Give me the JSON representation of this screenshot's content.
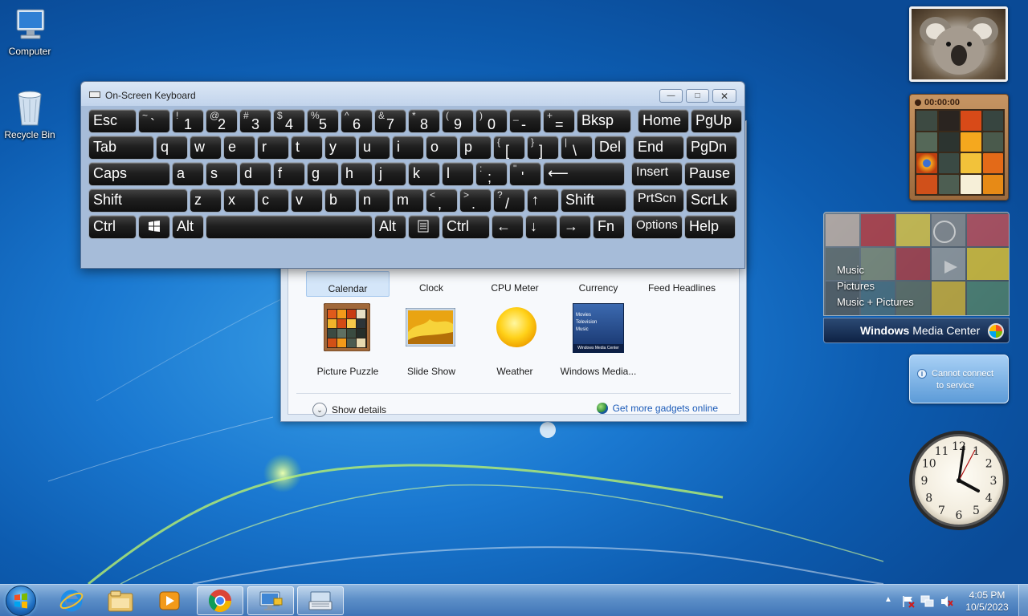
{
  "desktop": {
    "icons": [
      {
        "label": "Computer",
        "icon": "computer-icon"
      },
      {
        "label": "Recycle Bin",
        "icon": "recycle-bin-icon"
      }
    ]
  },
  "osk": {
    "title": "On-Screen Keyboard",
    "rows": [
      [
        {
          "label": "Esc"
        },
        {
          "shift": "~",
          "main": "`"
        },
        {
          "shift": "!",
          "main": "1"
        },
        {
          "shift": "@",
          "main": "2"
        },
        {
          "shift": "#",
          "main": "3"
        },
        {
          "shift": "$",
          "main": "4"
        },
        {
          "shift": "%",
          "main": "5"
        },
        {
          "shift": "^",
          "main": "6"
        },
        {
          "shift": "&",
          "main": "7"
        },
        {
          "shift": "*",
          "main": "8"
        },
        {
          "shift": "(",
          "main": "9"
        },
        {
          "shift": ")",
          "main": "0"
        },
        {
          "shift": "_",
          "main": "-"
        },
        {
          "shift": "+",
          "main": "="
        },
        {
          "label": "Bksp"
        },
        {
          "label": "Home"
        },
        {
          "label": "PgUp"
        }
      ],
      [
        {
          "label": "Tab"
        },
        {
          "label": "q"
        },
        {
          "label": "w"
        },
        {
          "label": "e"
        },
        {
          "label": "r"
        },
        {
          "label": "t"
        },
        {
          "label": "y"
        },
        {
          "label": "u"
        },
        {
          "label": "i"
        },
        {
          "label": "o"
        },
        {
          "label": "p"
        },
        {
          "shift": "{",
          "main": "["
        },
        {
          "shift": "}",
          "main": "]"
        },
        {
          "shift": "|",
          "main": "\\"
        },
        {
          "label": "Del"
        },
        {
          "label": "End"
        },
        {
          "label": "PgDn"
        }
      ],
      [
        {
          "label": "Caps"
        },
        {
          "label": "a"
        },
        {
          "label": "s"
        },
        {
          "label": "d"
        },
        {
          "label": "f"
        },
        {
          "label": "g"
        },
        {
          "label": "h"
        },
        {
          "label": "j"
        },
        {
          "label": "k"
        },
        {
          "label": "l"
        },
        {
          "shift": ":",
          "main": ";"
        },
        {
          "shift": "\"",
          "main": "'"
        },
        {
          "label": "⟵"
        },
        {
          "label": "Insert"
        },
        {
          "label": "Pause"
        }
      ],
      [
        {
          "label": "Shift"
        },
        {
          "label": "z"
        },
        {
          "label": "x"
        },
        {
          "label": "c"
        },
        {
          "label": "v"
        },
        {
          "label": "b"
        },
        {
          "label": "n"
        },
        {
          "label": "m"
        },
        {
          "shift": "<",
          "main": ","
        },
        {
          "shift": ">",
          "main": "."
        },
        {
          "shift": "?",
          "main": "/"
        },
        {
          "label": "↑"
        },
        {
          "label": "Shift"
        },
        {
          "label": "PrtScn"
        },
        {
          "label": "ScrLk"
        }
      ],
      [
        {
          "label": "Ctrl"
        },
        {
          "label": "",
          "icon": "windows-logo-icon"
        },
        {
          "label": "Alt"
        },
        {
          "label": ""
        },
        {
          "label": "Alt"
        },
        {
          "label": "",
          "icon": "menu-icon"
        },
        {
          "label": "Ctrl"
        },
        {
          "label": "←"
        },
        {
          "label": "↓"
        },
        {
          "label": "→"
        },
        {
          "label": "Fn"
        },
        {
          "label": "Options"
        },
        {
          "label": "Help"
        }
      ]
    ]
  },
  "gallery": {
    "top_row": [
      "Calendar",
      "Clock",
      "CPU Meter",
      "Currency",
      "Feed Headlines"
    ],
    "bottom_row": [
      "Picture Puzzle",
      "Slide Show",
      "Weather",
      "Windows Media..."
    ],
    "thumb_wmc_lines": [
      "Movies",
      "Television",
      "Music"
    ],
    "thumb_wmc_caption": "Windows Media Center",
    "show_details": "Show details",
    "more_gadgets": "Get more gadgets online"
  },
  "gadgets": {
    "puzzle_timer": "00:00:00",
    "wmc_menu": [
      "Music",
      "Pictures",
      "Music + Pictures"
    ],
    "wmc_title_bold": "Windows",
    "wmc_title_rest": " Media Center",
    "feed_message_line1": "Cannot connect",
    "feed_message_line2": "to service",
    "clock_numbers": [
      "12",
      "1",
      "2",
      "3",
      "4",
      "5",
      "6",
      "7",
      "8",
      "9",
      "10",
      "11"
    ]
  },
  "taskbar": {
    "time": "4:05 PM",
    "date": "10/5/2023",
    "buttons": [
      "internet-explorer-icon",
      "file-explorer-icon",
      "media-player-icon",
      "chrome-icon",
      "remote-desktop-icon",
      "on-screen-keyboard-icon"
    ]
  },
  "colors": {
    "taskbar": "#5d8fc8",
    "key_face": "#1f1f1f",
    "link": "#1a5ab8"
  }
}
